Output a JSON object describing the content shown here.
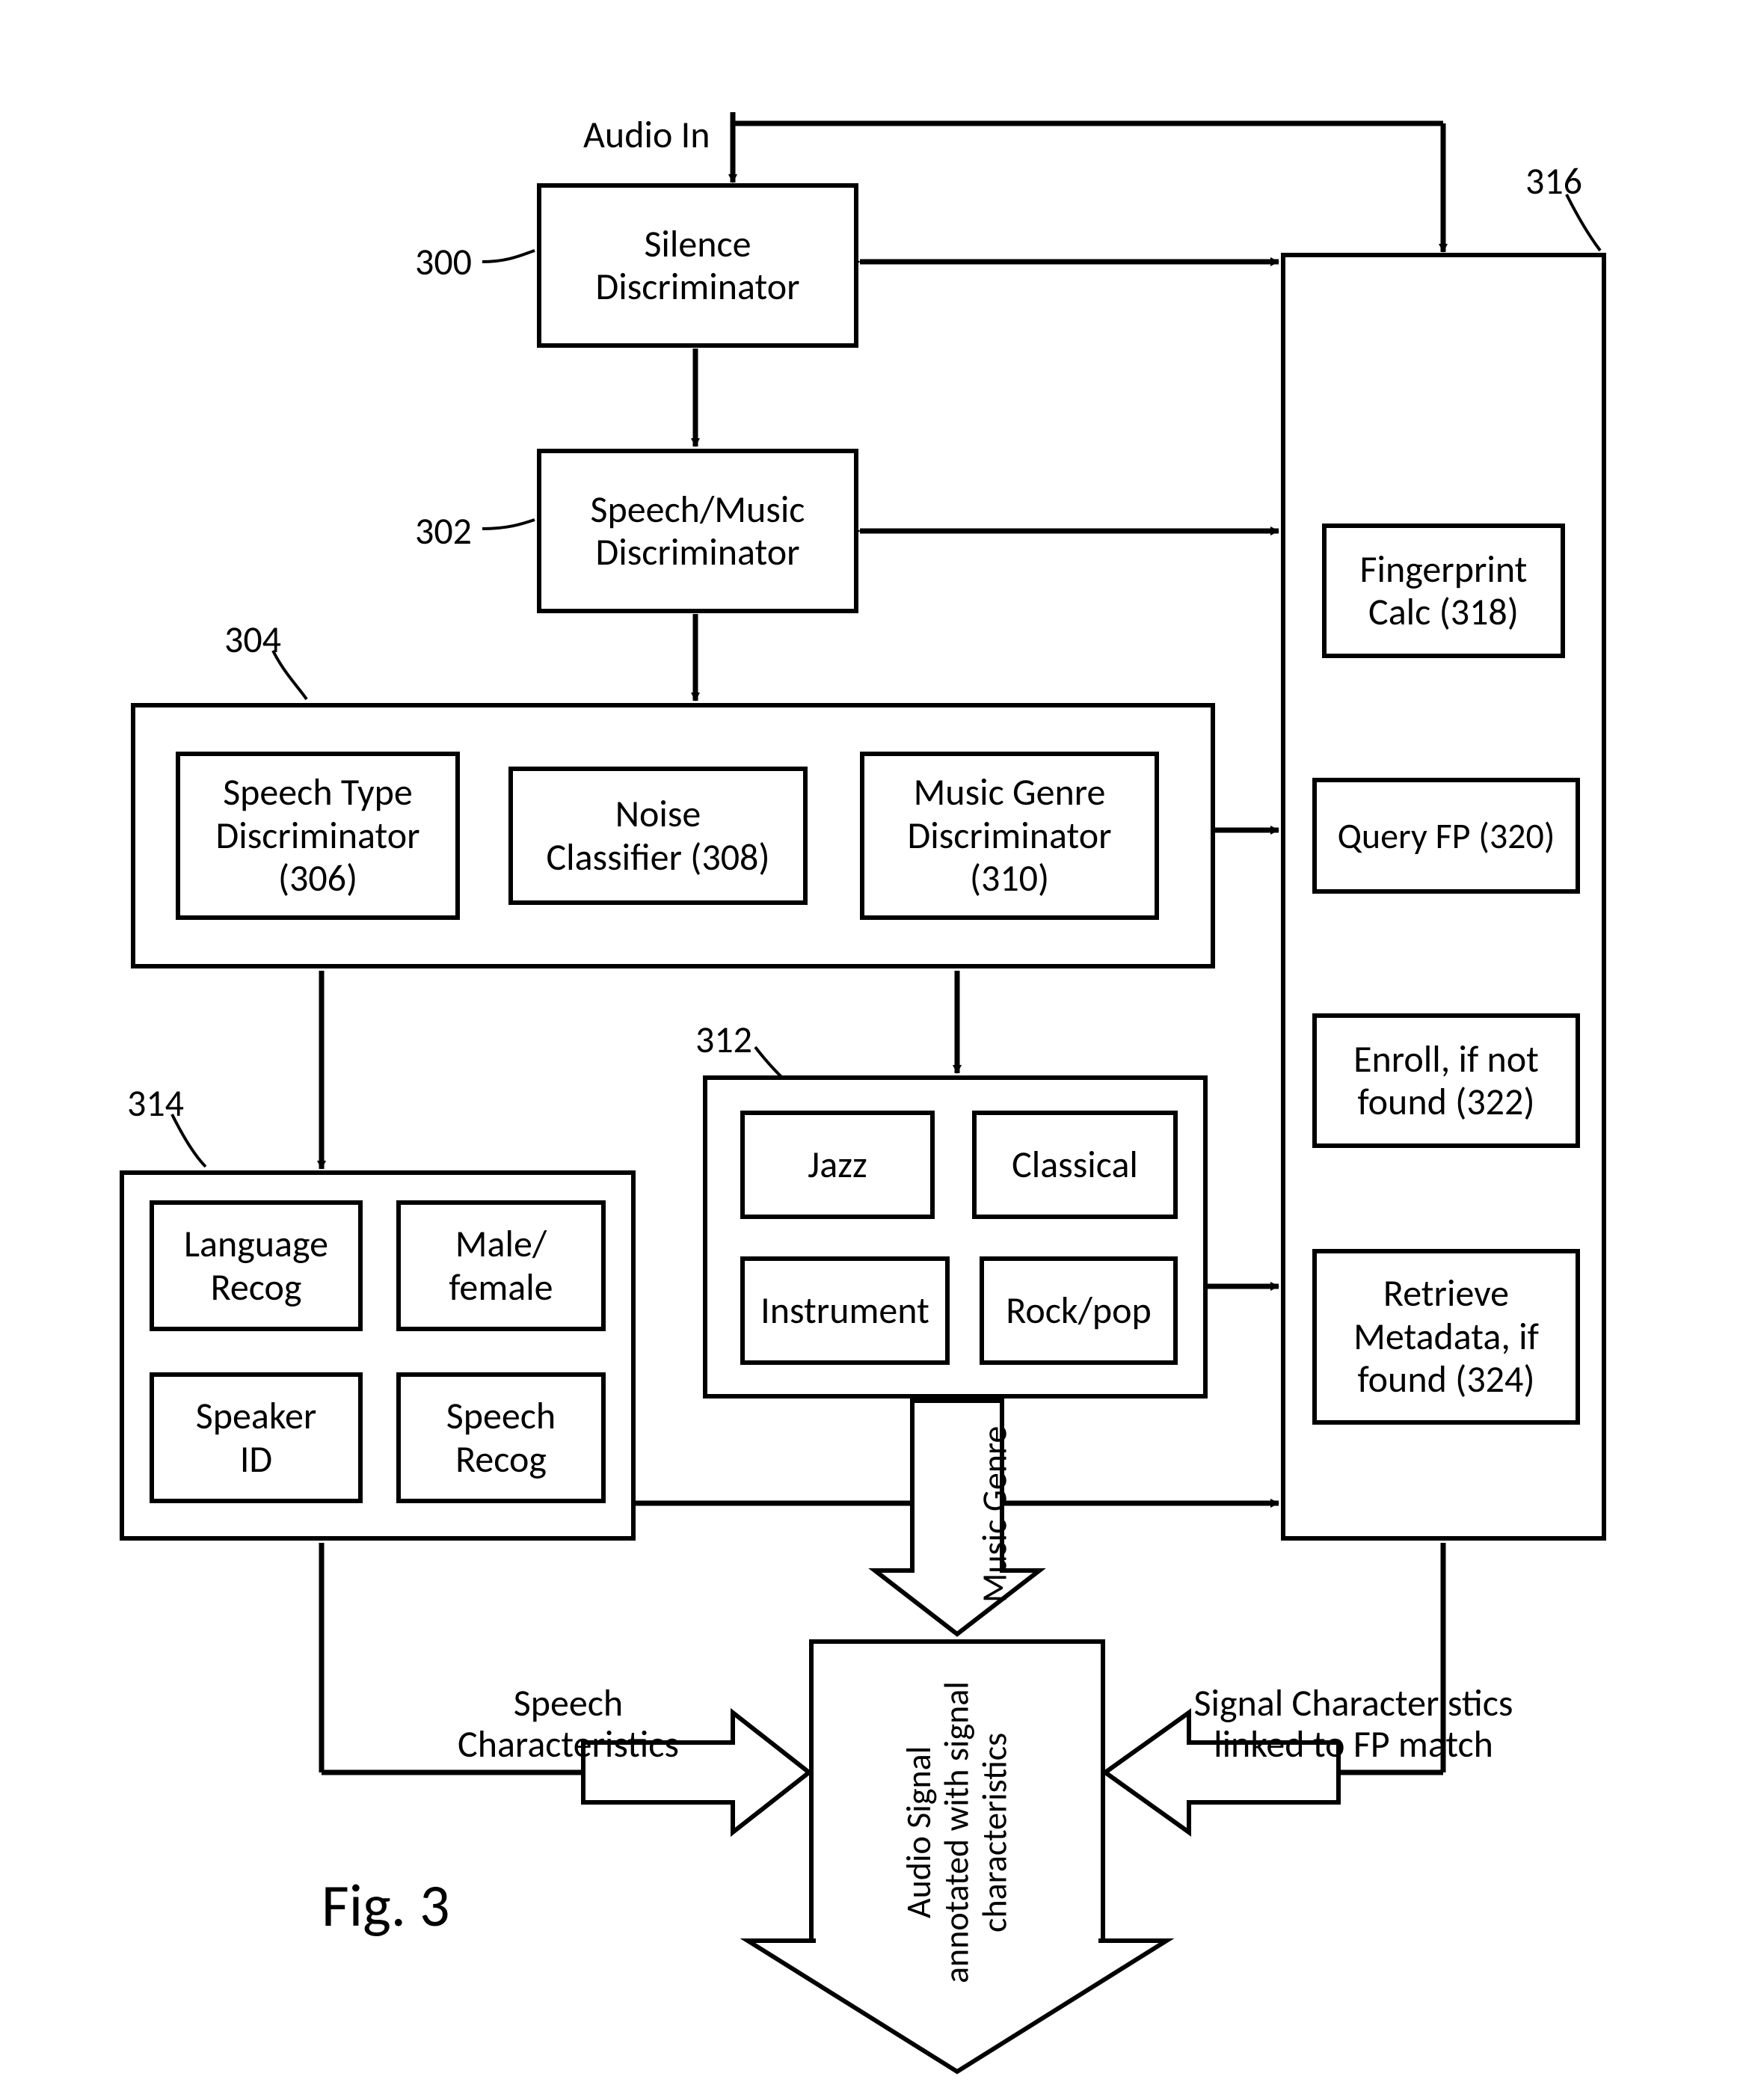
{
  "audioIn": "Audio In",
  "silence": "Silence\nDiscriminator",
  "speechMusic": "Speech/Music\nDiscriminator",
  "speechType": "Speech Type\nDiscriminator\n(306)",
  "noiseClassifier": "Noise\nClassifier (308)",
  "musicGenre": "Music Genre\nDiscriminator\n(310)",
  "jazz": "Jazz",
  "classical": "Classical",
  "instrument": "Instrument",
  "rockpop": "Rock/pop",
  "langRecog": "Language\nRecog",
  "maleFemale": "Male/\nfemale",
  "speakerId": "Speaker\nID",
  "speechRecog": "Speech\nRecog",
  "fingerprint": "Fingerprint\nCalc (318)",
  "queryFp": "Query FP (320)",
  "enroll": "Enroll, if not\nfound (322)",
  "retrieve": "Retrieve\nMetadata, if\nfound (324)",
  "musicGenreLabel": "Music Genre",
  "speechChars": "Speech\nCharacteristics",
  "signalChars": "Signal Characteristics\nlinked to FP match",
  "audioSignal": "Audio Signal\nannotated with signal\ncharacteristics",
  "fig": "Fig. 3",
  "ref300": "300",
  "ref302": "302",
  "ref304": "304",
  "ref312": "312",
  "ref314": "314",
  "ref316": "316"
}
